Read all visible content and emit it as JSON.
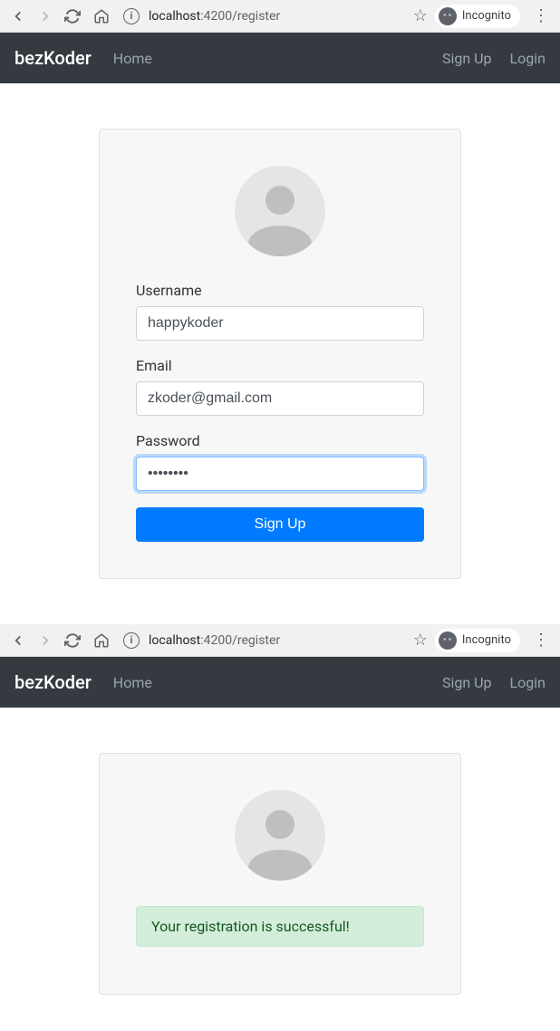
{
  "browser": {
    "url_host": "localhost",
    "url_path": ":4200/register",
    "incognito_label": "Incognito"
  },
  "navbar": {
    "brand": "bezKoder",
    "home": "Home",
    "signup": "Sign Up",
    "login": "Login"
  },
  "form": {
    "username_label": "Username",
    "username_value": "happykoder",
    "email_label": "Email",
    "email_value": "zkoder@gmail.com",
    "password_label": "Password",
    "password_value": "••••••••",
    "submit_label": "Sign Up"
  },
  "success": {
    "message": "Your registration is successful!"
  }
}
